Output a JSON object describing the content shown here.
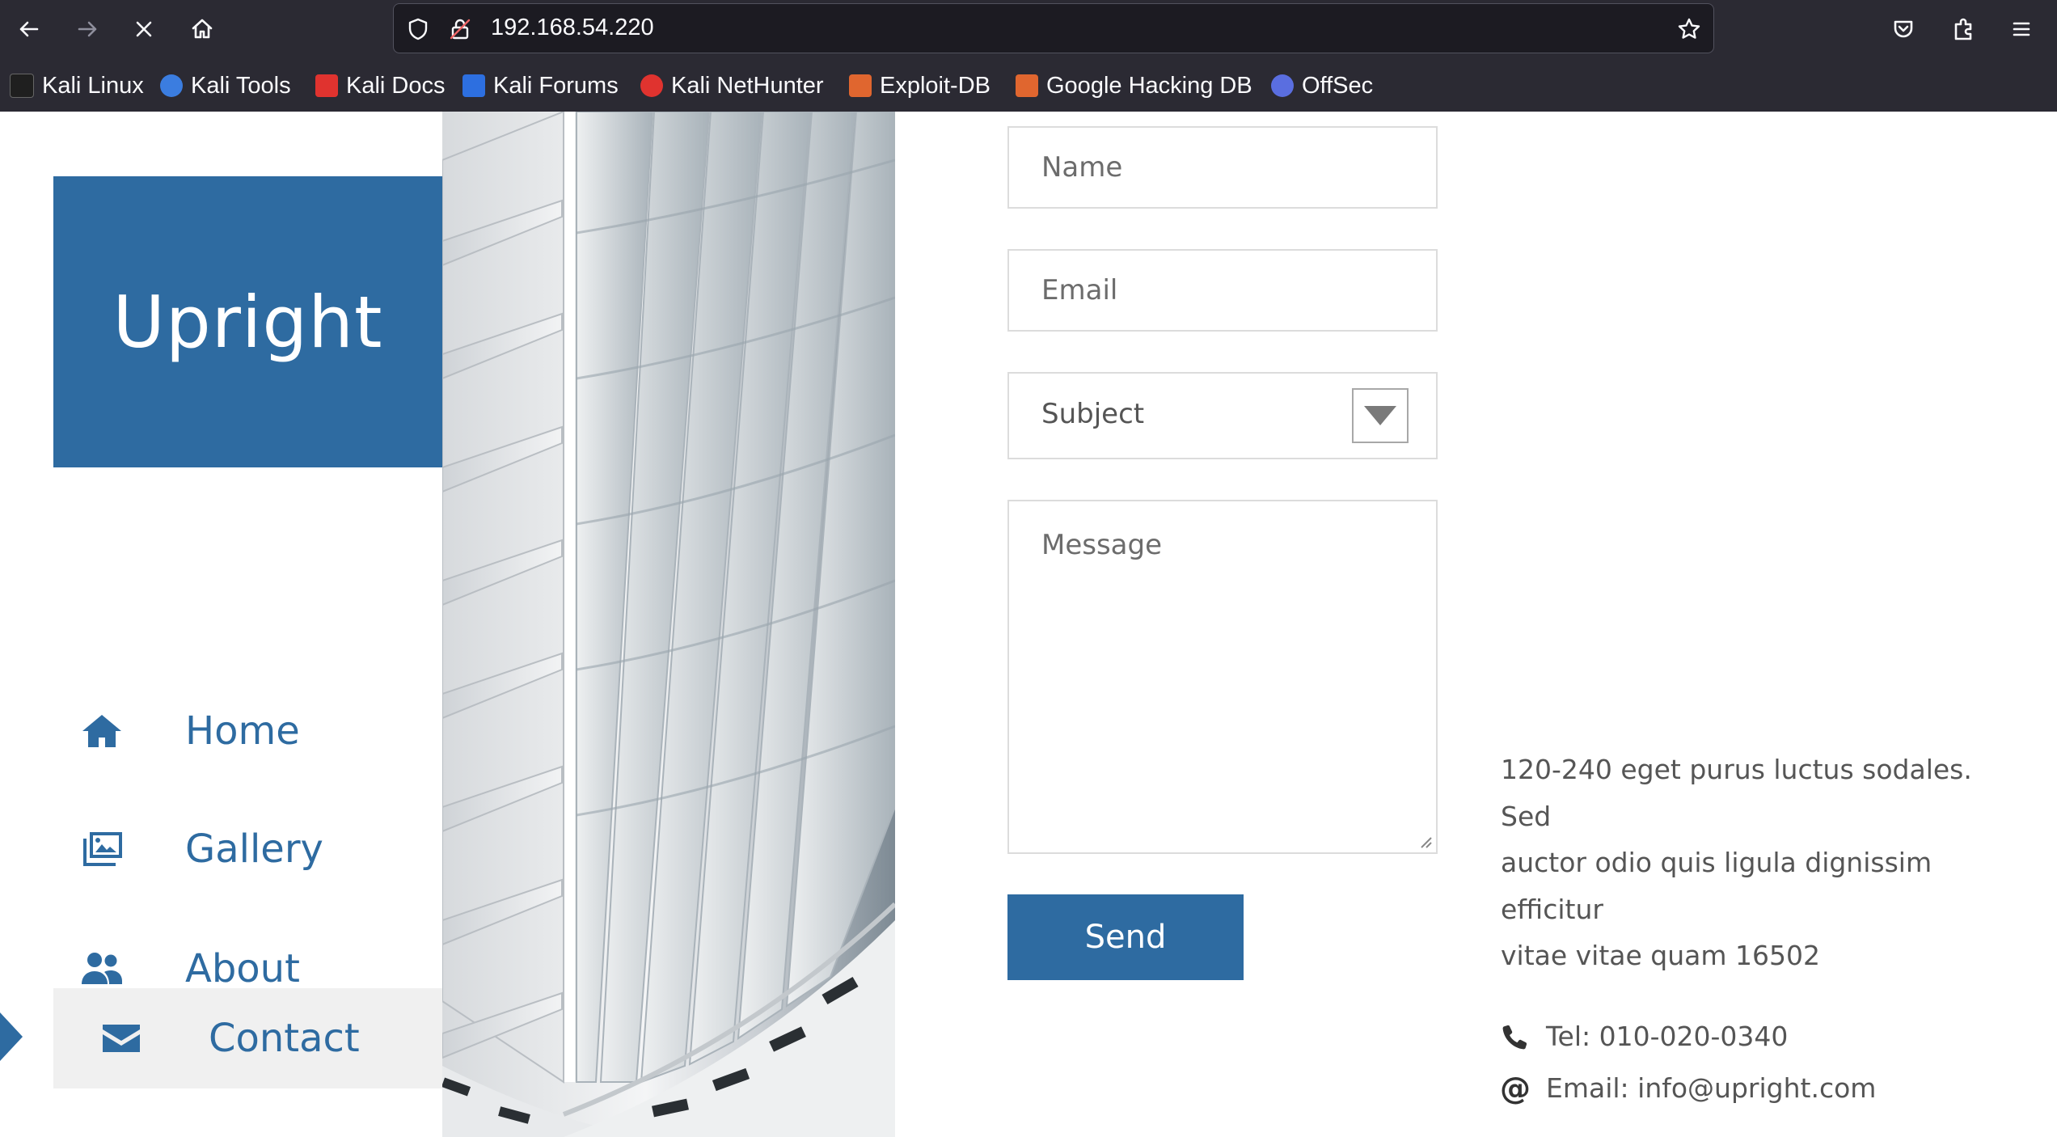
{
  "browser": {
    "url": "192.168.54.220",
    "bookmarks": [
      {
        "label": "Kali Linux",
        "color": "#1f1f1f"
      },
      {
        "label": "Kali Tools",
        "color": "#3b7de0"
      },
      {
        "label": "Kali Docs",
        "color": "#e0332f"
      },
      {
        "label": "Kali Forums",
        "color": "#2d6fe0"
      },
      {
        "label": "Kali NetHunter",
        "color": "#e0332f"
      },
      {
        "label": "Exploit-DB",
        "color": "#e0662f"
      },
      {
        "label": "Google Hacking DB",
        "color": "#e0662f"
      },
      {
        "label": "OffSec",
        "color": "#5a6ee0"
      }
    ]
  },
  "site": {
    "brand": "Upright",
    "accent_color": "#2e6ba1",
    "nav": [
      {
        "label": "Home",
        "icon": "home-icon"
      },
      {
        "label": "Gallery",
        "icon": "gallery-icon"
      },
      {
        "label": "About",
        "icon": "users-icon"
      },
      {
        "label": "Contact",
        "icon": "envelope-icon",
        "active": true
      }
    ]
  },
  "form": {
    "name_placeholder": "Name",
    "email_placeholder": "Email",
    "subject_value": "Subject",
    "message_placeholder": "Message",
    "send_label": "Send"
  },
  "contact": {
    "address_lines": [
      "120-240 eget purus luctus sodales.",
      "Sed",
      "auctor odio quis ligula dignissim",
      "efficitur",
      "vitae vitae quam 16502"
    ],
    "tel": "Tel: 010-020-0340",
    "email": "Email: info@upright.com",
    "at_symbol": "@"
  }
}
